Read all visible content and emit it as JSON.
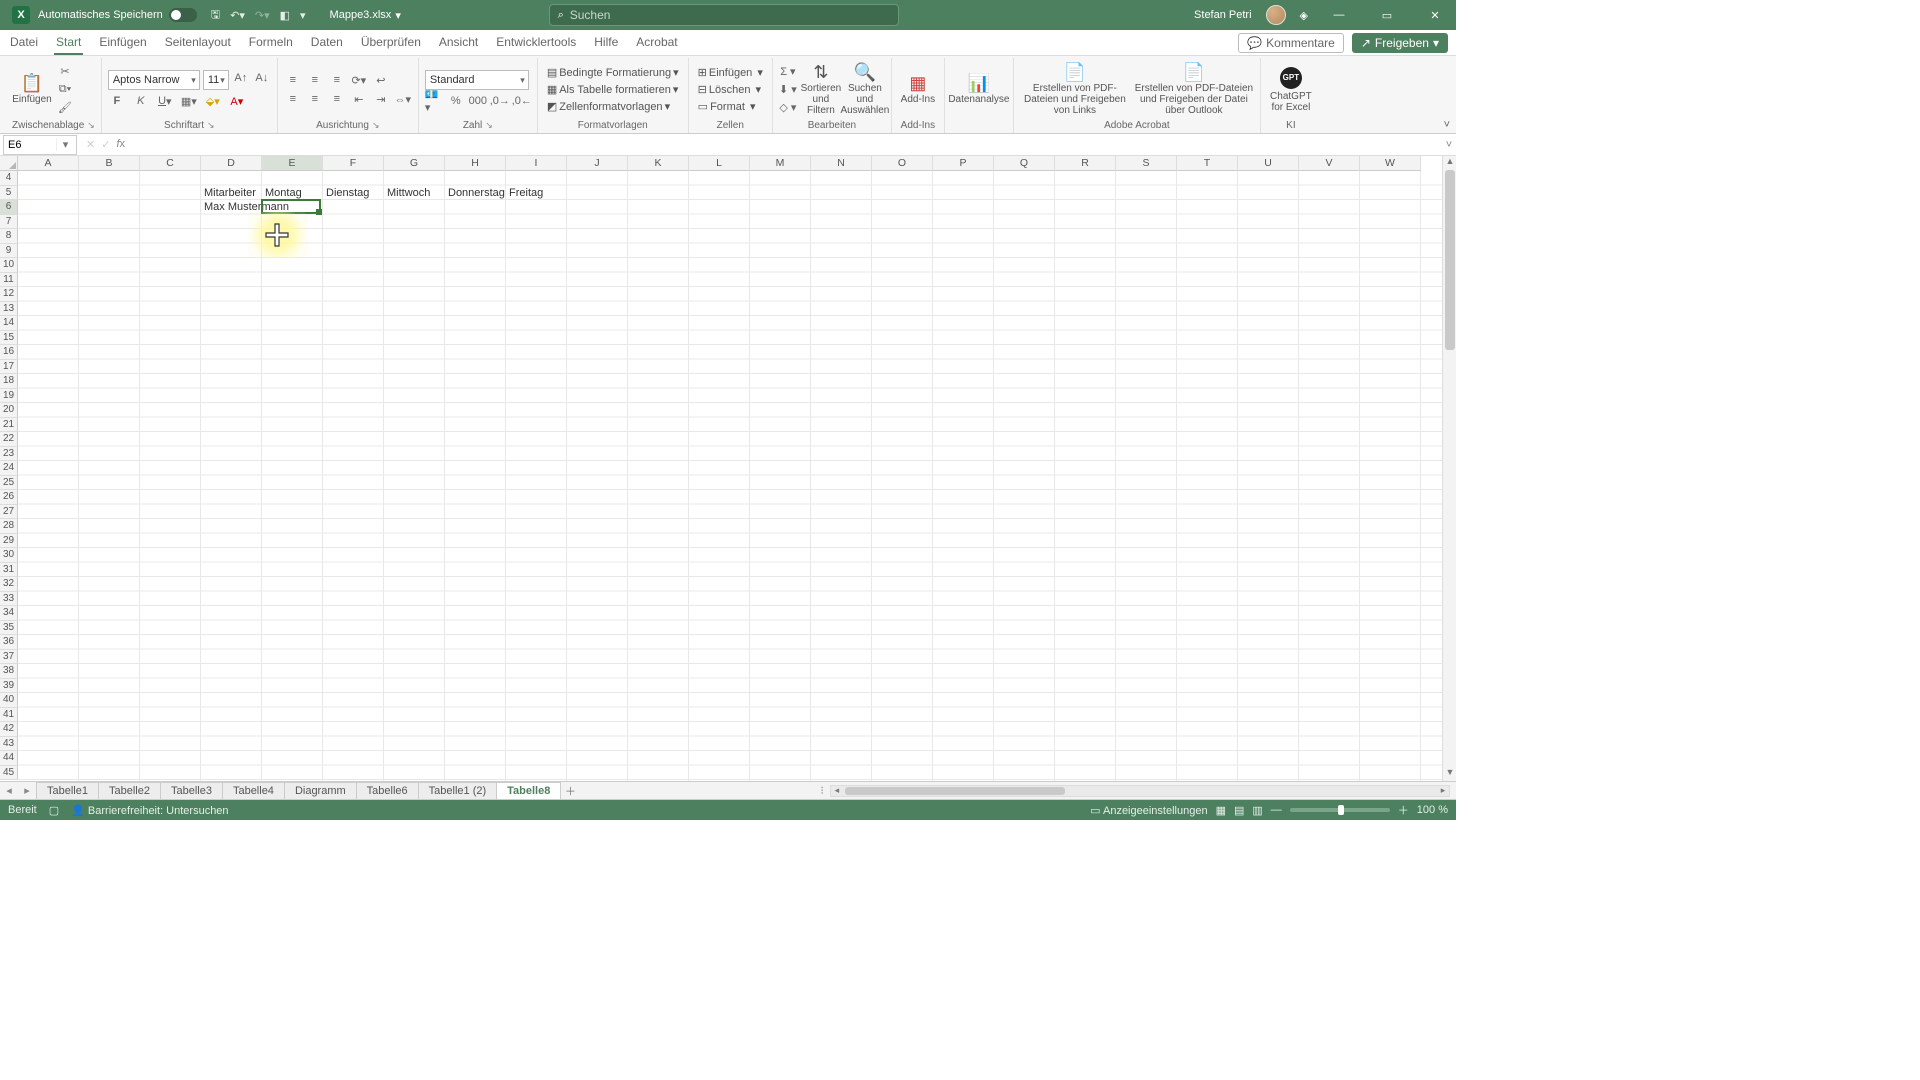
{
  "title": {
    "autosave": "Automatisches Speichern",
    "docname": "Mappe3.xlsx",
    "user": "Stefan Petri",
    "search_placeholder": "Suchen"
  },
  "tabs": {
    "items": [
      "Datei",
      "Start",
      "Einfügen",
      "Seitenlayout",
      "Formeln",
      "Daten",
      "Überprüfen",
      "Ansicht",
      "Entwicklertools",
      "Hilfe",
      "Acrobat"
    ],
    "active": 1,
    "comments": "Kommentare",
    "share": "Freigeben"
  },
  "ribbon": {
    "clipboard": {
      "paste": "Einfügen",
      "label": "Zwischenablage"
    },
    "font": {
      "name": "Aptos Narrow",
      "size": "11",
      "label": "Schriftart"
    },
    "align": {
      "label": "Ausrichtung"
    },
    "number": {
      "format": "Standard",
      "label": "Zahl"
    },
    "styles": {
      "cond": "Bedingte Formatierung",
      "table": "Als Tabelle formatieren",
      "cellstyles": "Zellenformatvorlagen",
      "label": "Formatvorlagen"
    },
    "cells": {
      "insert": "Einfügen",
      "delete": "Löschen",
      "format": "Format",
      "label": "Zellen"
    },
    "edit": {
      "sort": "Sortieren und Filtern",
      "find": "Suchen und Auswählen",
      "label": "Bearbeiten"
    },
    "addins": {
      "addins": "Add-Ins",
      "label": "Add-Ins"
    },
    "analysis": {
      "data": "Datenanalyse"
    },
    "adobe": {
      "pdf1": "Erstellen von PDF-Dateien und Freigeben von Links",
      "pdf2": "Erstellen von PDF-Dateien und Freigeben der Datei über Outlook",
      "label": "Adobe Acrobat"
    },
    "gpt": {
      "name": "ChatGPT for Excel",
      "label": "KI"
    }
  },
  "namebox": {
    "ref": "E6"
  },
  "columns": [
    "A",
    "B",
    "C",
    "D",
    "E",
    "F",
    "G",
    "H",
    "I",
    "J",
    "K",
    "L",
    "M",
    "N",
    "O",
    "P",
    "Q",
    "R",
    "S",
    "T",
    "U",
    "V",
    "W"
  ],
  "first_row": 4,
  "row_count": 42,
  "selected_col": 4,
  "selected_row": 2,
  "cells": [
    {
      "col": 3,
      "row": 1,
      "text": "Mitarbeiter"
    },
    {
      "col": 4,
      "row": 1,
      "text": "Montag"
    },
    {
      "col": 5,
      "row": 1,
      "text": "Dienstag"
    },
    {
      "col": 6,
      "row": 1,
      "text": "Mittwoch"
    },
    {
      "col": 7,
      "row": 1,
      "text": "Donnerstag"
    },
    {
      "col": 8,
      "row": 1,
      "text": "Freitag"
    },
    {
      "col": 3,
      "row": 2,
      "text": "Max Mustermann"
    }
  ],
  "active_cell": {
    "col": 4,
    "row": 2
  },
  "sheets": {
    "items": [
      "Tabelle1",
      "Tabelle2",
      "Tabelle3",
      "Tabelle4",
      "Diagramm",
      "Tabelle6",
      "Tabelle1 (2)",
      "Tabelle8"
    ],
    "active": 7
  },
  "status": {
    "ready": "Bereit",
    "access": "Barrierefreiheit: Untersuchen",
    "display": "Anzeigeeinstellungen",
    "zoom": "100 %"
  }
}
